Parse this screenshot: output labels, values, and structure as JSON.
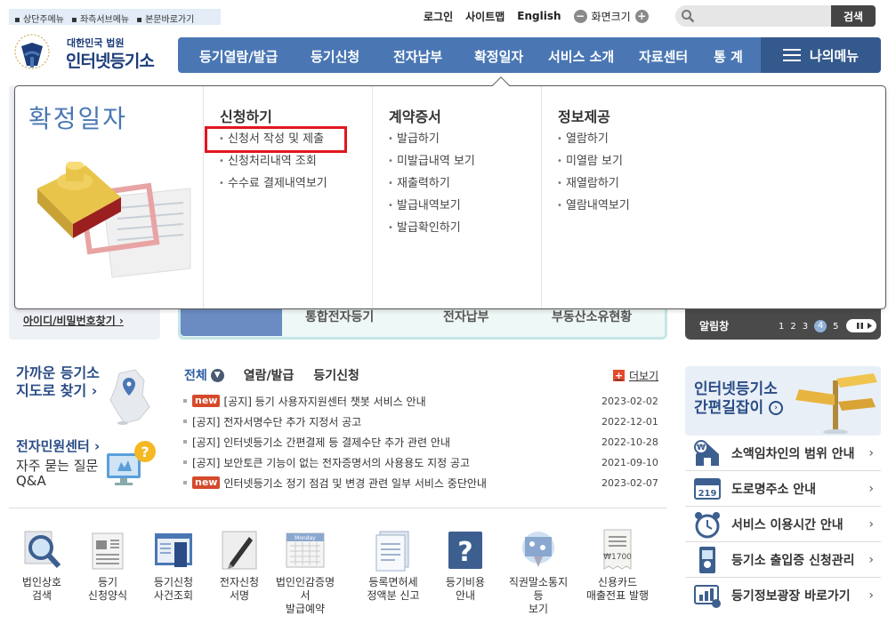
{
  "skip_links": [
    "상단주메뉴",
    "좌측서브메뉴",
    "본문바로가기"
  ],
  "util": {
    "login": "로그인",
    "sitemap": "사이트맵",
    "english": "English",
    "zoom_label": "화면크기",
    "minus": "−",
    "plus": "+"
  },
  "search": {
    "placeholder": "",
    "button": "검색"
  },
  "logo": {
    "sub": "대한민국 법원",
    "main": "인터넷등기소"
  },
  "nav": [
    "등기열람/발급",
    "등기신청",
    "전자납부",
    "확정일자",
    "서비스 소개",
    "자료센터",
    "통 계"
  ],
  "my_menu": "나의메뉴",
  "mega": {
    "title": "확정일자",
    "columns": [
      {
        "head": "신청하기",
        "items": [
          "신청서 작성 및 제출",
          "신청처리내역 조회",
          "수수료 결제내역보기"
        ]
      },
      {
        "head": "계약증서",
        "items": [
          "발급하기",
          "미발급내역 보기",
          "재출력하기",
          "발급내역보기",
          "발급확인하기"
        ]
      },
      {
        "head": "정보제공",
        "items": [
          "열람하기",
          "미열람 보기",
          "재열람하기",
          "열람내역보기"
        ]
      }
    ]
  },
  "behind": {
    "id_find": "아이디/비밀번호찾기 ›",
    "mid_items": [
      "통합전자등기",
      "전자납부",
      "부동산소유현황"
    ],
    "alarm": "알림창",
    "alarm_pages": [
      "1",
      "2",
      "3",
      "4",
      "5"
    ],
    "alarm_active": "4"
  },
  "left": {
    "near_line1": "가까운 등기소",
    "near_line2": "지도로 찾기 ›",
    "civil": "전자민원센터 ›",
    "faq_line1": "자주 묻는 질문",
    "faq_line2": "Q&A"
  },
  "notice": {
    "tabs": [
      "전체",
      "열람/발급",
      "등기신청"
    ],
    "more": "더보기",
    "new_badge": "new",
    "rows": [
      {
        "new": true,
        "title": "[공지] 등기 사용자지원센터 챗봇 서비스 안내",
        "date": "2023-02-02"
      },
      {
        "new": false,
        "title": "[공지] 전자서명수단 추가 지정서 공고",
        "date": "2022-12-01"
      },
      {
        "new": false,
        "title": "[공지] 인터넷등기소 간편결제 등 결제수단 추가 관련 안내",
        "date": "2022-10-28"
      },
      {
        "new": false,
        "title": "[공지] 보안토큰 기능이 없는 전자증명서의 사용용도 지정 공고",
        "date": "2021-09-10"
      },
      {
        "new": true,
        "title": "인터넷등기소 정기 점검 및 변경 관련 일부 서비스 중단안내",
        "date": "2023-02-07"
      }
    ]
  },
  "quick": [
    "법인상호\n검색",
    "등기\n신청양식",
    "등기신청\n사건조회",
    "전자신청\n서명",
    "법인인감증명서\n발급예약",
    "등록면허세\n정액분 신고",
    "등기비용\n안내",
    "직권말소통지등\n보기",
    "신용카드\n매출전표 발행"
  ],
  "quick_icon_text": {
    "calendar": "Monday",
    "receipt": "₩1700"
  },
  "right": {
    "shortcut_line1": "인터넷등기소",
    "shortcut_line2": "간편길잡이",
    "links": [
      "소액임차인의 범위 안내",
      "도로명주소 안내",
      "서비스 이용시간 안내",
      "등기소 출입증 신청관리",
      "등기정보광장 바로가기"
    ],
    "road_sign_number": "219"
  },
  "colors": {
    "nav": "#4a77b4",
    "my_menu": "#34598c",
    "highlight": "#e0161f",
    "new": "#d54a2b"
  }
}
